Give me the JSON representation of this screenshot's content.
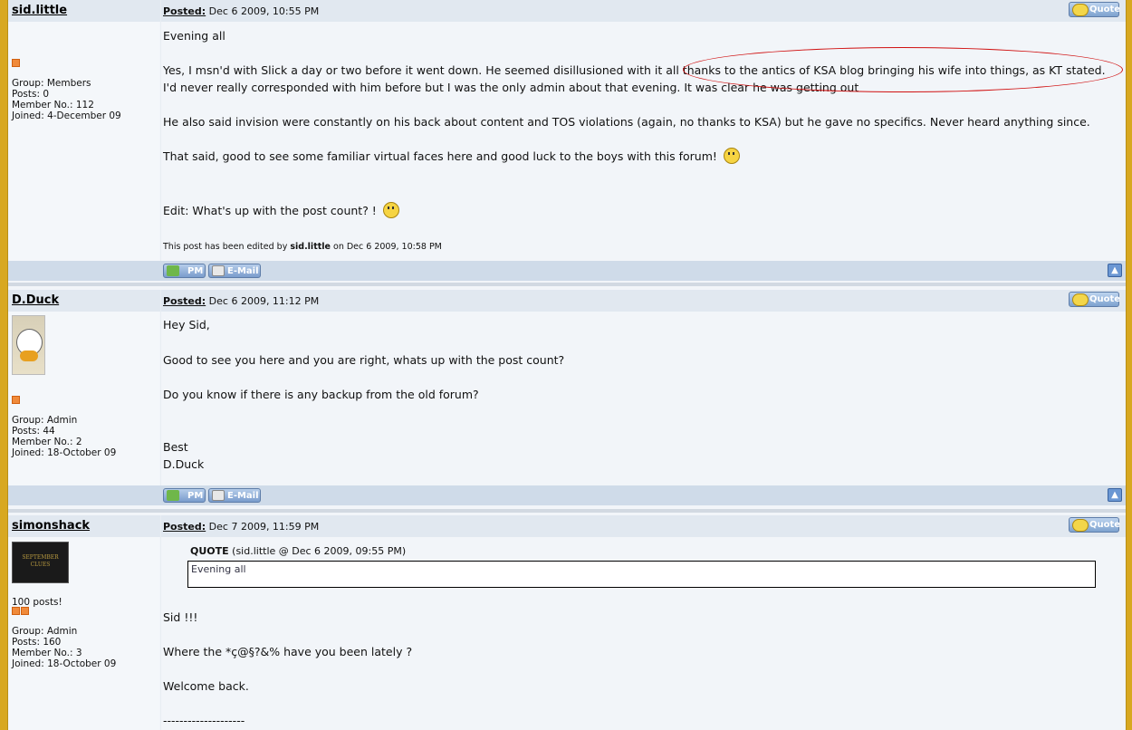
{
  "posts": [
    {
      "author": "sid.little",
      "posted_label": "Posted:",
      "posted_date": "Dec 6 2009, 10:55 PM",
      "group": "Group: Members",
      "posts": "Posts: 0",
      "member_no": "Member No.: 112",
      "joined": "Joined: 4-December 09",
      "body": [
        "Evening all",
        "Yes, I msn'd with Slick a day or two before it went down. He seemed disillusioned with it all thanks to the antics of KSA blog bringing his wife into things, as KT stated.",
        "I'd never really corresponded with him before but I was the only admin about that evening. It was clear he was getting out",
        "He also said invision were constantly on his back about content and TOS violations (again, no thanks to KSA) but he gave no specifics. Never heard anything since.",
        "That said, good to see some familiar virtual faces here and good luck to the boys with this forum!",
        "Edit: What's up with the post count? !"
      ],
      "edit_prefix": "This post has been edited by",
      "edit_user": "sid.little",
      "edit_suffix": "on Dec 6 2009, 10:58 PM"
    },
    {
      "author": "D.Duck",
      "posted_label": "Posted:",
      "posted_date": "Dec 6 2009, 11:12 PM",
      "group": "Group: Admin",
      "posts": "Posts: 44",
      "member_no": "Member No.: 2",
      "joined": "Joined: 18-October 09",
      "body": [
        "Hey Sid,",
        "Good to see you here and you are right, whats up with the post count?",
        "Do you know if there is any backup from the old forum?",
        "Best",
        "D.Duck"
      ]
    },
    {
      "author": "simonshack",
      "posted_label": "Posted:",
      "posted_date": "Dec 7 2009, 11:59 PM",
      "badge": "100 posts!",
      "avatar_text": "SEPTEMBER CLUES",
      "group": "Group: Admin",
      "posts": "Posts: 160",
      "member_no": "Member No.: 3",
      "joined": "Joined: 18-October 09",
      "quote_label": "QUOTE",
      "quote_source": "(sid.little @ Dec 6 2009, 09:55 PM)",
      "quote_text": "Evening all",
      "body": [
        "Sid !!!",
        "Where the *ç@§?&% have you been lately ?",
        "Welcome back.",
        "--------------------"
      ]
    }
  ],
  "buttons": {
    "quote": "Quote",
    "pm": "PM",
    "email": "E-Mail",
    "top": "▲"
  },
  "icons": {
    "quote": "quote-icon",
    "pm": "pm-icon",
    "email": "email-icon",
    "smiley": "smiley-icon",
    "top": "arrow-up-icon"
  }
}
